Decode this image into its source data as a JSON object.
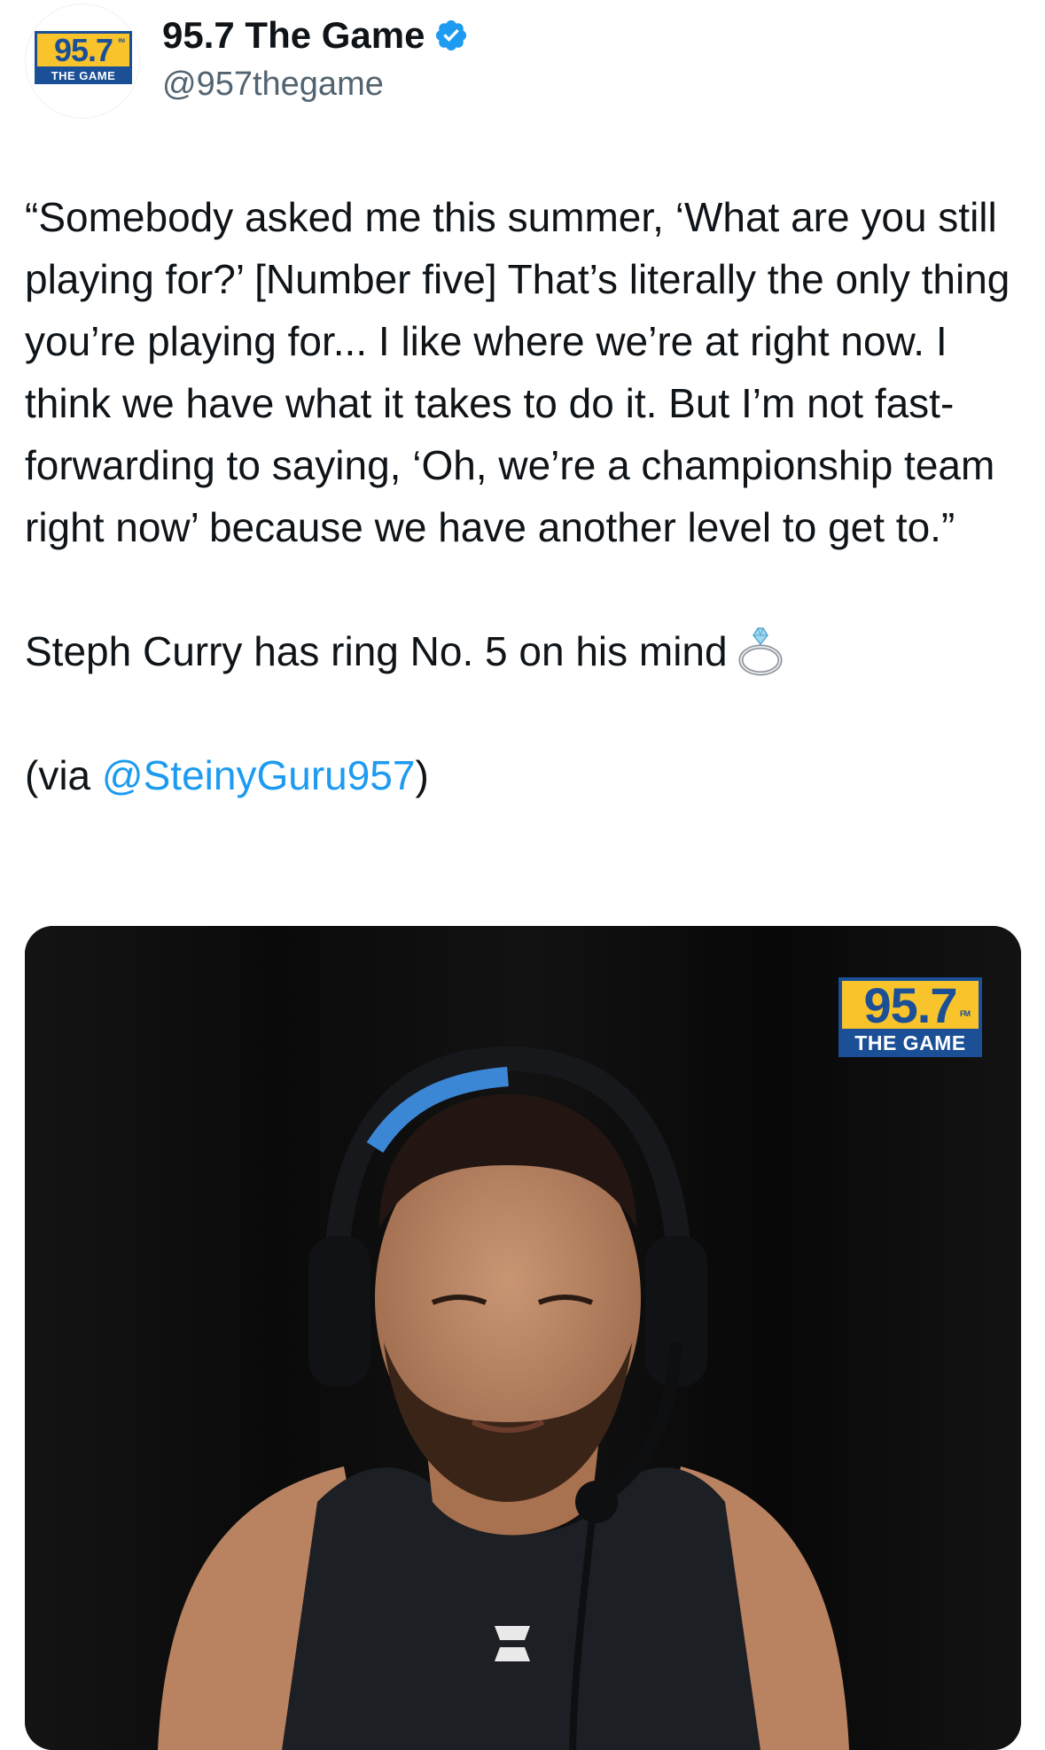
{
  "account": {
    "display_name": "95.7 The Game",
    "handle": "@957thegame",
    "verified": true,
    "avatar_logo": {
      "number": "95.7",
      "fm": "FM",
      "subtitle": "THE GAME"
    }
  },
  "tweet": {
    "quote": "“Somebody asked me this summer, ‘What are you still playing for?’ [Number five] That’s literally the only thing you’re playing for... I like where we’re at right now. I think we have what it takes to do it. But I’m not fast-forwarding to saying, ‘Oh, we’re a championship team right now’ because we have another level to get to.”",
    "line2_text": "Steph Curry has ring No. 5 on his mind",
    "line2_emoji": "ring-icon",
    "via_prefix": "(via ",
    "via_mention": "@SteinyGuru957",
    "via_suffix": ")"
  },
  "media": {
    "watermark": {
      "number": "95.7",
      "fm": "FM",
      "subtitle": "THE GAME"
    },
    "icon": "video-frame-person-headset"
  },
  "colors": {
    "link": "#1d9bf0",
    "secondary_text": "#536471",
    "logo_yellow": "#f9c32b",
    "logo_blue": "#1b4f96",
    "verified_blue": "#1d9bf0"
  }
}
